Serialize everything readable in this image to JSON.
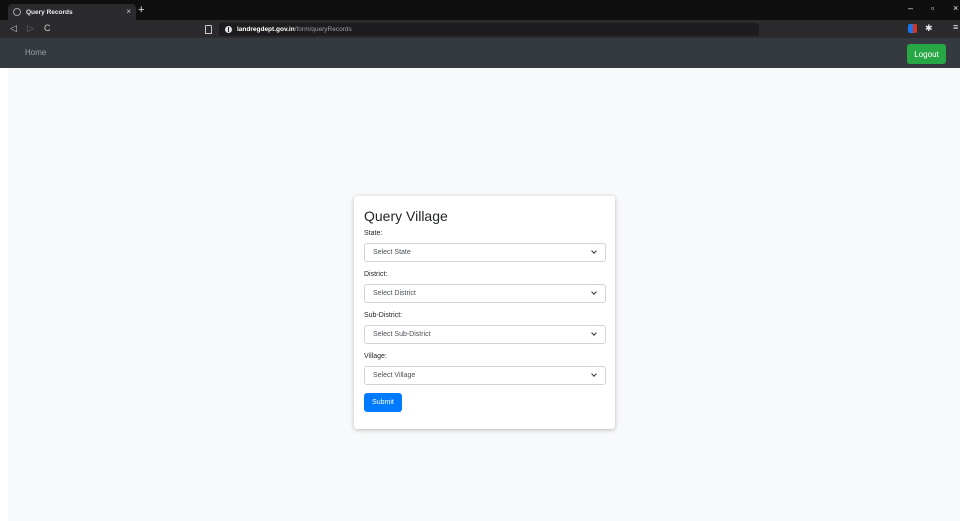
{
  "browser": {
    "tab_title": "Query Records",
    "tab_close": "×",
    "new_tab": "+",
    "url_host": "landregdept.gov.in",
    "url_path": "/form/queryRecords",
    "window_controls": {
      "minimize": "–",
      "maximize": "▫",
      "close": "×"
    },
    "nav": {
      "back": "◁",
      "forward": "▷",
      "reload": "C"
    },
    "extension_icon": "puzzle-icon",
    "menu_icon": "≡"
  },
  "navbar": {
    "home": "Home",
    "logout": "Logout",
    "colors": {
      "bg": "#343a40",
      "logout": "#28a745"
    }
  },
  "form": {
    "title": "Query Village",
    "fields": [
      {
        "label": "State:",
        "selected": "Select State"
      },
      {
        "label": "District:",
        "selected": "Select District"
      },
      {
        "label": "Sub-District:",
        "selected": "Select Sub-District"
      },
      {
        "label": "Village:",
        "selected": "Select Village"
      }
    ],
    "submit": "Submit",
    "colors": {
      "submit": "#007bff"
    }
  }
}
